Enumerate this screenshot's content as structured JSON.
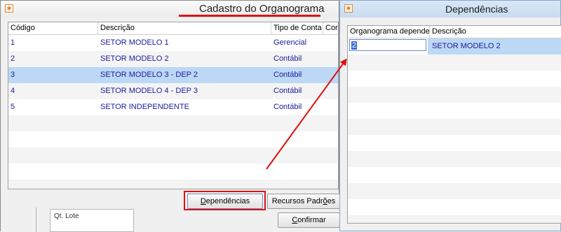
{
  "left_window": {
    "title": "Cadastro do Organograma",
    "columns": [
      "Código",
      "Descrição",
      "Tipo de Conta",
      "Cont"
    ],
    "rows": [
      {
        "codigo": "1",
        "descricao": "SETOR MODELO 1",
        "tipo": "Gerencial"
      },
      {
        "codigo": "2",
        "descricao": "SETOR MODELO 2",
        "tipo": "Contábil"
      },
      {
        "codigo": "3",
        "descricao": "SETOR MODELO 3 - DEP 2",
        "tipo": "Contábil"
      },
      {
        "codigo": "4",
        "descricao": "SETOR MODELO 4 - DEP 3",
        "tipo": "Contábil"
      },
      {
        "codigo": "5",
        "descricao": "SETOR INDEPENDENTE",
        "tipo": "Contábil"
      }
    ],
    "selected_row": 2,
    "buttons": {
      "dependencias_pre": "D",
      "dependencias_rest": "ependências",
      "recursos_pre": "Recursos Padr",
      "recursos_u": "õ",
      "recursos_post": "es",
      "confirmar_pre": "C",
      "confirmar_rest": "onfirmar"
    },
    "background_label": "Qt. Lote"
  },
  "right_window": {
    "title": "Dependências",
    "columns": [
      "Organograma dependente",
      "Descrição"
    ],
    "rows": [
      {
        "dependente": "2",
        "descricao": "SETOR MODELO 2"
      }
    ]
  },
  "colors": {
    "highlight_red": "#e01010",
    "selection_blue": "#bcd8f5",
    "text_blue": "#1a1aa0"
  }
}
